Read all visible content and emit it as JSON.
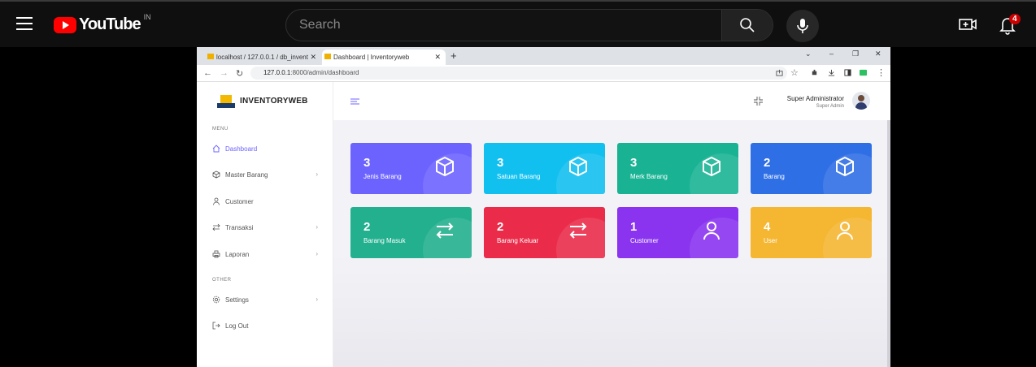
{
  "youtube": {
    "logo_text": "YouTube",
    "country": "IN",
    "search_placeholder": "Search",
    "notif_count": "4"
  },
  "browser": {
    "tabs": [
      {
        "title": "localhost / 127.0.0.1 / db_invent"
      },
      {
        "title": "Dashboard | Inventoryweb"
      }
    ],
    "url_host": "127.0.0.1",
    "url_path": ":8000/admin/dashboard"
  },
  "app": {
    "brand": "INVENTORYWEB",
    "menu_label": "MENU",
    "other_label": "OTHER",
    "menu": [
      {
        "label": "Dashboard",
        "icon": "home-icon",
        "has_submenu": false,
        "active": true
      },
      {
        "label": "Master Barang",
        "icon": "box-icon",
        "has_submenu": true,
        "active": false
      },
      {
        "label": "Customer",
        "icon": "user-icon",
        "has_submenu": false,
        "active": false
      },
      {
        "label": "Transaksi",
        "icon": "swap-icon",
        "has_submenu": true,
        "active": false
      },
      {
        "label": "Laporan",
        "icon": "printer-icon",
        "has_submenu": true,
        "active": false
      }
    ],
    "other": [
      {
        "label": "Settings",
        "icon": "gear-icon",
        "has_submenu": true
      },
      {
        "label": "Log Out",
        "icon": "logout-icon",
        "has_submenu": false
      }
    ],
    "user": {
      "name": "Super Administrator",
      "role": "Super Admin"
    },
    "cards": [
      {
        "value": "3",
        "label": "Jenis Barang",
        "color": "#6c63ff",
        "icon": "box-icon"
      },
      {
        "value": "3",
        "label": "Satuan Barang",
        "color": "#12c0f0",
        "icon": "box-icon"
      },
      {
        "value": "3",
        "label": "Merk Barang",
        "color": "#19b394",
        "icon": "box-icon"
      },
      {
        "value": "2",
        "label": "Barang",
        "color": "#2f6fe6",
        "icon": "box-icon"
      },
      {
        "value": "2",
        "label": "Barang Masuk",
        "color": "#22b08e",
        "icon": "swap-icon"
      },
      {
        "value": "2",
        "label": "Barang Keluar",
        "color": "#ea2c4a",
        "icon": "swap-icon"
      },
      {
        "value": "1",
        "label": "Customer",
        "color": "#8a34f0",
        "icon": "user-icon"
      },
      {
        "value": "4",
        "label": "User",
        "color": "#f5b631",
        "icon": "user-icon"
      }
    ]
  }
}
